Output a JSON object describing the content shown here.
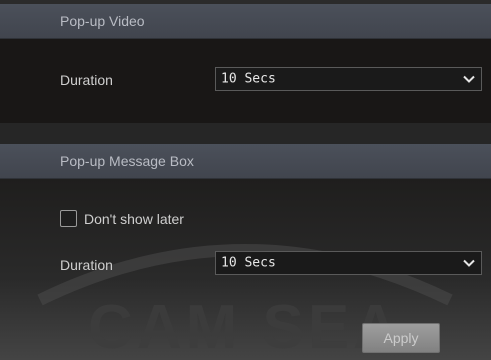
{
  "popup_video": {
    "title": "Pop-up Video",
    "duration_label": "Duration",
    "duration_value": "10 Secs"
  },
  "popup_message": {
    "title": "Pop-up Message Box",
    "dont_show_label": "Don't show later",
    "dont_show_checked": false,
    "duration_label": "Duration",
    "duration_value": "10 Secs"
  },
  "watermark": {
    "text": "CAM SEA"
  },
  "actions": {
    "apply_label": "Apply"
  },
  "icons": {
    "dropdown": "chevron-down-icon",
    "checkbox": "checkbox-unchecked-icon"
  },
  "colors": {
    "header_bg": "#45494f",
    "panel_bg": "#191716",
    "button_bg": "#a0a0a0"
  }
}
